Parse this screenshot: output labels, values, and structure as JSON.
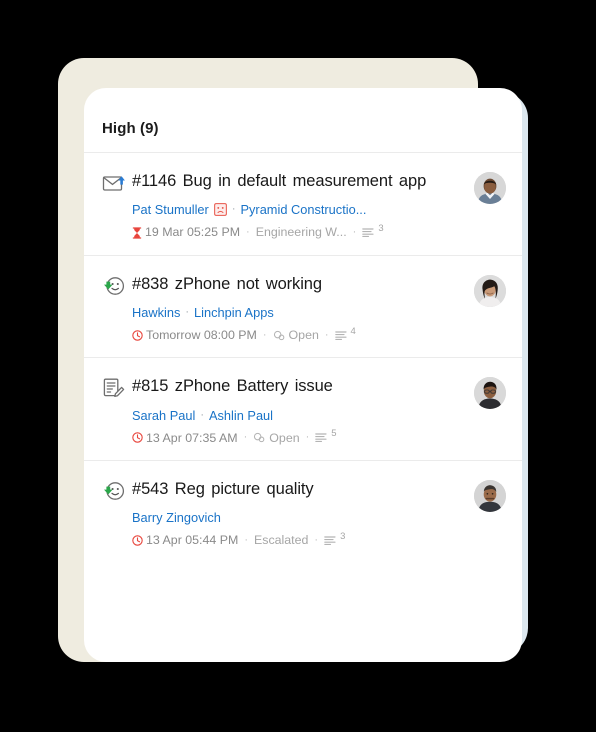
{
  "panel": {
    "title": "High  (9)"
  },
  "tickets": [
    {
      "channel_icon": "email-reply-icon",
      "id": "#1146",
      "subject": "Bug in default measurement app",
      "requester": "Pat Stumuller",
      "mood_icon": "sad-face-badge-icon",
      "account": "Pyramid Constructio...",
      "due_icon": "hourglass-icon",
      "due": "19 Mar 05:25 PM",
      "status_icon": "",
      "status": "Engineering W...",
      "thread_icon": "thread-lines-icon",
      "thread_count": "3",
      "avatar": "avatar-male-1"
    },
    {
      "channel_icon": "chat-inbound-icon",
      "id": "#838",
      "subject": "zPhone not working",
      "requester": "Hawkins",
      "mood_icon": "",
      "account": "Linchpin Apps",
      "due_icon": "clock-icon",
      "due": "Tomorrow 08:00 PM",
      "status_icon": "status-circles-icon",
      "status": "Open",
      "thread_icon": "thread-lines-icon",
      "thread_count": "4",
      "avatar": "avatar-female-1"
    },
    {
      "channel_icon": "web-form-icon",
      "id": "#815",
      "subject": "zPhone Battery issue",
      "requester": "Sarah Paul",
      "mood_icon": "",
      "account": "Ashlin Paul",
      "due_icon": "clock-icon",
      "due": "13 Apr 07:35 AM",
      "status_icon": "status-circles-icon",
      "status": "Open",
      "thread_icon": "thread-lines-icon",
      "thread_count": "5",
      "avatar": "avatar-male-2"
    },
    {
      "channel_icon": "chat-inbound-icon",
      "id": "#543",
      "subject": "Reg picture quality",
      "requester": "Barry Zingovich",
      "mood_icon": "",
      "account": "",
      "due_icon": "clock-icon",
      "due": "13 Apr 05:44 PM",
      "status_icon": "",
      "status": "Escalated",
      "thread_icon": "thread-lines-icon",
      "thread_count": "3",
      "avatar": "avatar-male-3"
    }
  ],
  "colors": {
    "link": "#1a73c7",
    "due_red": "#e8453c",
    "muted": "#a6a6a6",
    "card_cream": "#efece0",
    "card_blue": "#dce7ee",
    "card_white": "#ffffff"
  }
}
